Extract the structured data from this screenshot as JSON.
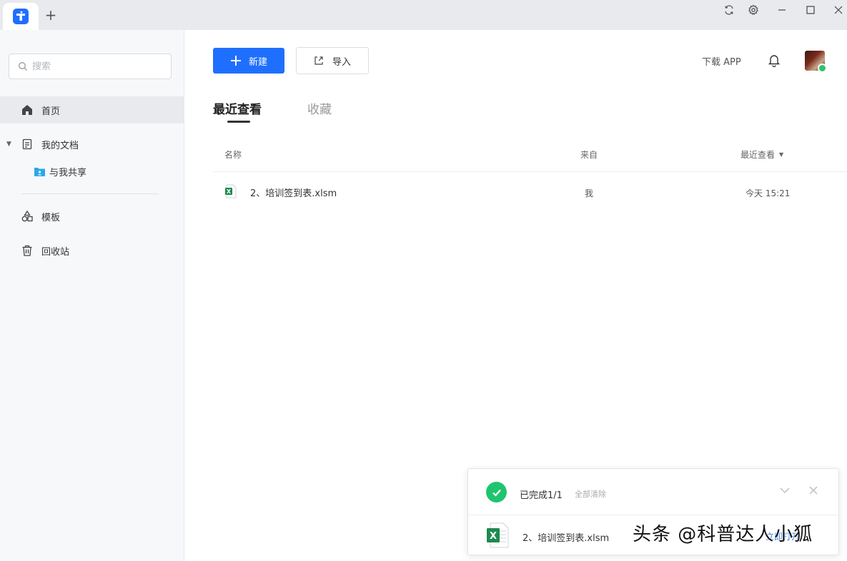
{
  "titlebar": {
    "new_tab_label": "+",
    "icons": [
      "sync-icon",
      "settings-icon",
      "minimize-icon",
      "maximize-icon",
      "close-icon"
    ]
  },
  "sidebar": {
    "search_placeholder": "搜索",
    "items": [
      {
        "label": "首页",
        "icon": "home-icon",
        "active": true
      },
      {
        "label": "我的文档",
        "icon": "document-icon"
      },
      {
        "label": "与我共享",
        "icon": "shared-folder-icon"
      },
      {
        "label": "模板",
        "icon": "template-icon"
      },
      {
        "label": "回收站",
        "icon": "trash-icon"
      }
    ]
  },
  "toolbar": {
    "new_label": "新建",
    "import_label": "导入",
    "download_app": "下载 APP"
  },
  "tabs": [
    {
      "label": "最近查看",
      "active": true
    },
    {
      "label": "收藏"
    }
  ],
  "table": {
    "columns": [
      "名称",
      "来自",
      "最近查看"
    ],
    "rows": [
      {
        "name": "2、培训签到表.xlsm",
        "from": "我",
        "time": "今天 15:21"
      }
    ]
  },
  "upload_panel": {
    "status": "已完成1/1",
    "clear_all": "全部清除",
    "file_name": "2、培训签到表.xlsm",
    "action": "立即打开"
  },
  "watermark": "头条 @科普达人小狐",
  "colors": {
    "accent": "#1f6fff",
    "success": "#1fc56e",
    "excel": "#1d8a4f"
  }
}
